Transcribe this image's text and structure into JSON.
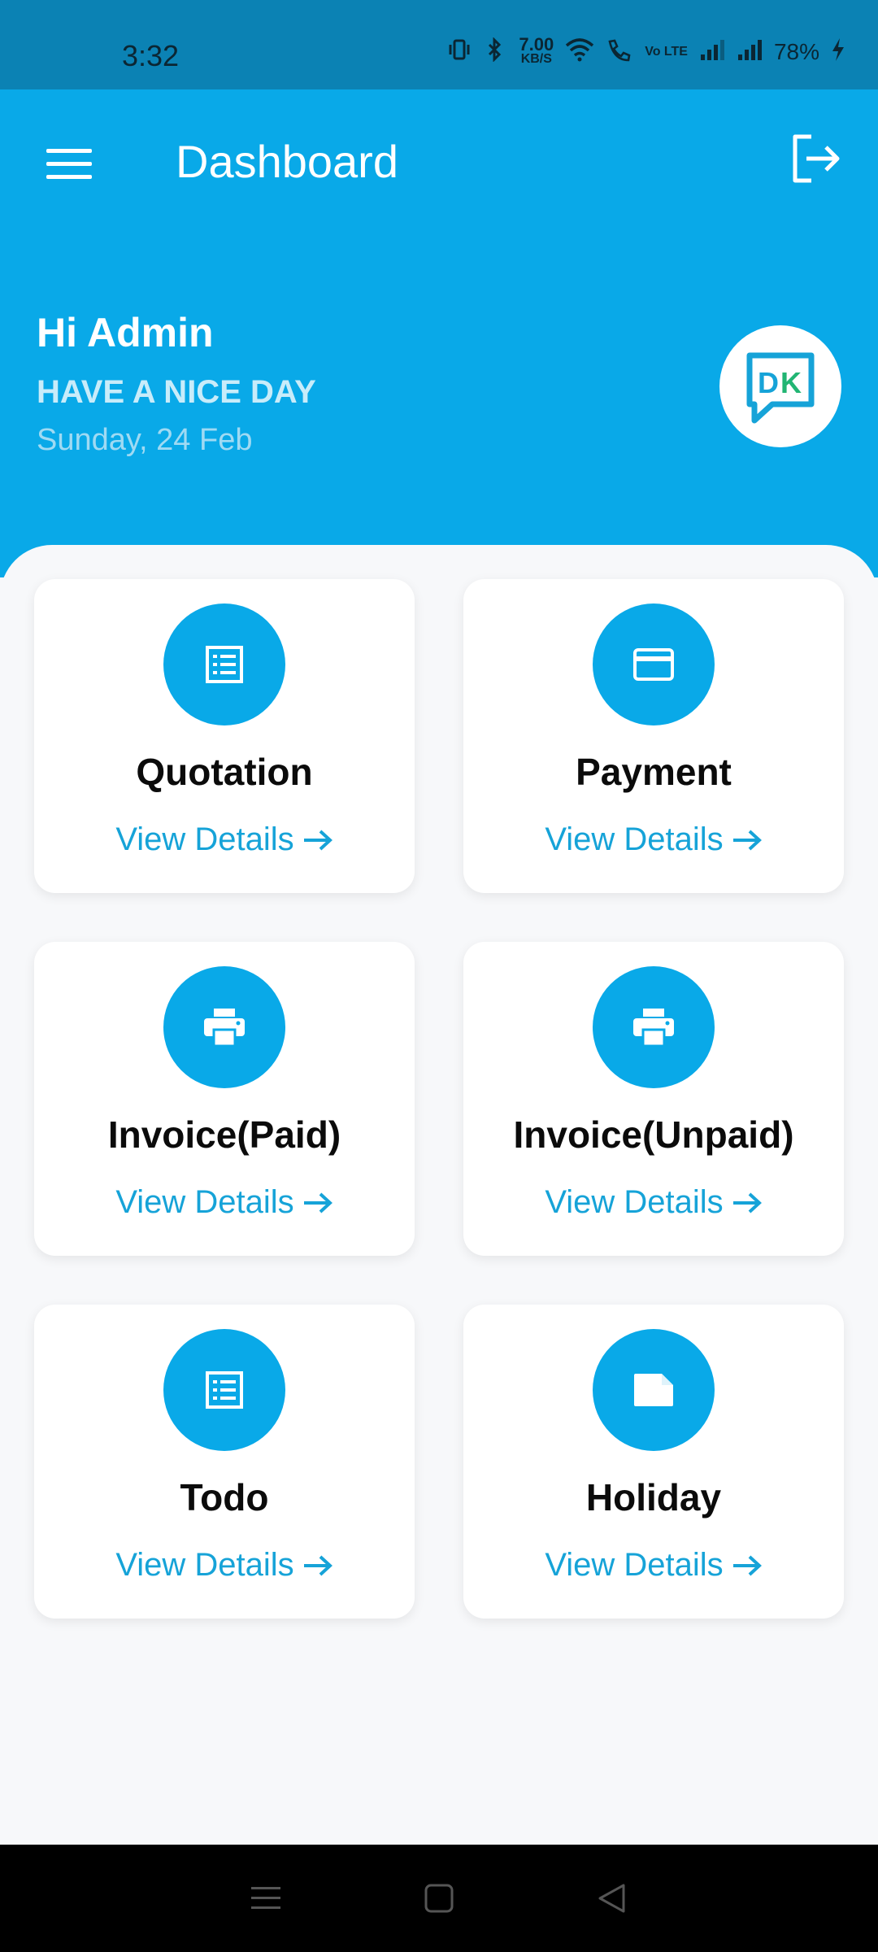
{
  "status_bar": {
    "time": "3:32",
    "speed_value": "7.00",
    "speed_unit": "KB/S",
    "volte": "Vo LTE",
    "battery": "78%"
  },
  "header": {
    "title": "Dashboard",
    "menu_icon": "hamburger-menu-icon",
    "logout_icon": "logout-icon"
  },
  "greeting": {
    "hello": "Hi Admin",
    "subtitle": "HAVE A NICE DAY",
    "date": "Sunday, 24 Feb"
  },
  "logo": {
    "text": "DK"
  },
  "cards": [
    {
      "title": "Quotation",
      "link": "View Details",
      "icon": "list-icon"
    },
    {
      "title": "Payment",
      "link": "View Details",
      "icon": "credit-card-icon"
    },
    {
      "title": "Invoice(Paid)",
      "link": "View Details",
      "icon": "printer-icon"
    },
    {
      "title": "Invoice(Unpaid)",
      "link": "View Details",
      "icon": "printer-icon"
    },
    {
      "title": "Todo",
      "link": "View Details",
      "icon": "list-icon"
    },
    {
      "title": "Holiday",
      "link": "View Details",
      "icon": "note-icon"
    }
  ],
  "nav": {
    "recents_icon": "recents-icon",
    "home_icon": "home-icon",
    "back_icon": "back-icon"
  },
  "colors": {
    "primary": "#09a9e8",
    "status_bar": "#0b82b4",
    "link": "#16a3d8"
  }
}
